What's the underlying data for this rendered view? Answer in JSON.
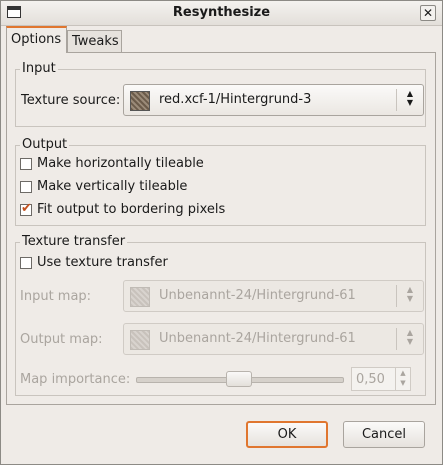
{
  "window": {
    "title": "Resynthesize",
    "close_glyph": "✕"
  },
  "tabs": [
    {
      "label": "Options",
      "active": true
    },
    {
      "label": "Tweaks",
      "active": false
    }
  ],
  "input": {
    "frame_label": "Input",
    "texture_source_label": "Texture source:",
    "texture_source_value": "red.xcf-1/Hintergrund-3"
  },
  "output": {
    "frame_label": "Output",
    "options": [
      {
        "label": "Make horizontally tileable",
        "checked": false
      },
      {
        "label": "Make vertically tileable",
        "checked": false
      },
      {
        "label": "Fit output to bordering pixels",
        "checked": true
      }
    ]
  },
  "texture_transfer": {
    "frame_label": "Texture transfer",
    "use_label": "Use texture transfer",
    "use_checked": false,
    "input_map_label": "Input map:",
    "input_map_value": "Unbenannt-24/Hintergrund-61",
    "output_map_label": "Output map:",
    "output_map_value": "Unbenannt-24/Hintergrund-61",
    "map_importance_label": "Map importance:",
    "map_importance_value": "0,50"
  },
  "buttons": {
    "ok": "OK",
    "cancel": "Cancel"
  },
  "colors": {
    "accent": "#e0762f",
    "check": "#c4511f",
    "background": "#efebe7"
  },
  "icons": {
    "window": "window-icon",
    "close": "close-icon",
    "combo_arrows": "updown-arrows-icon",
    "texture_thumb": "texture-thumbnail-icon"
  }
}
